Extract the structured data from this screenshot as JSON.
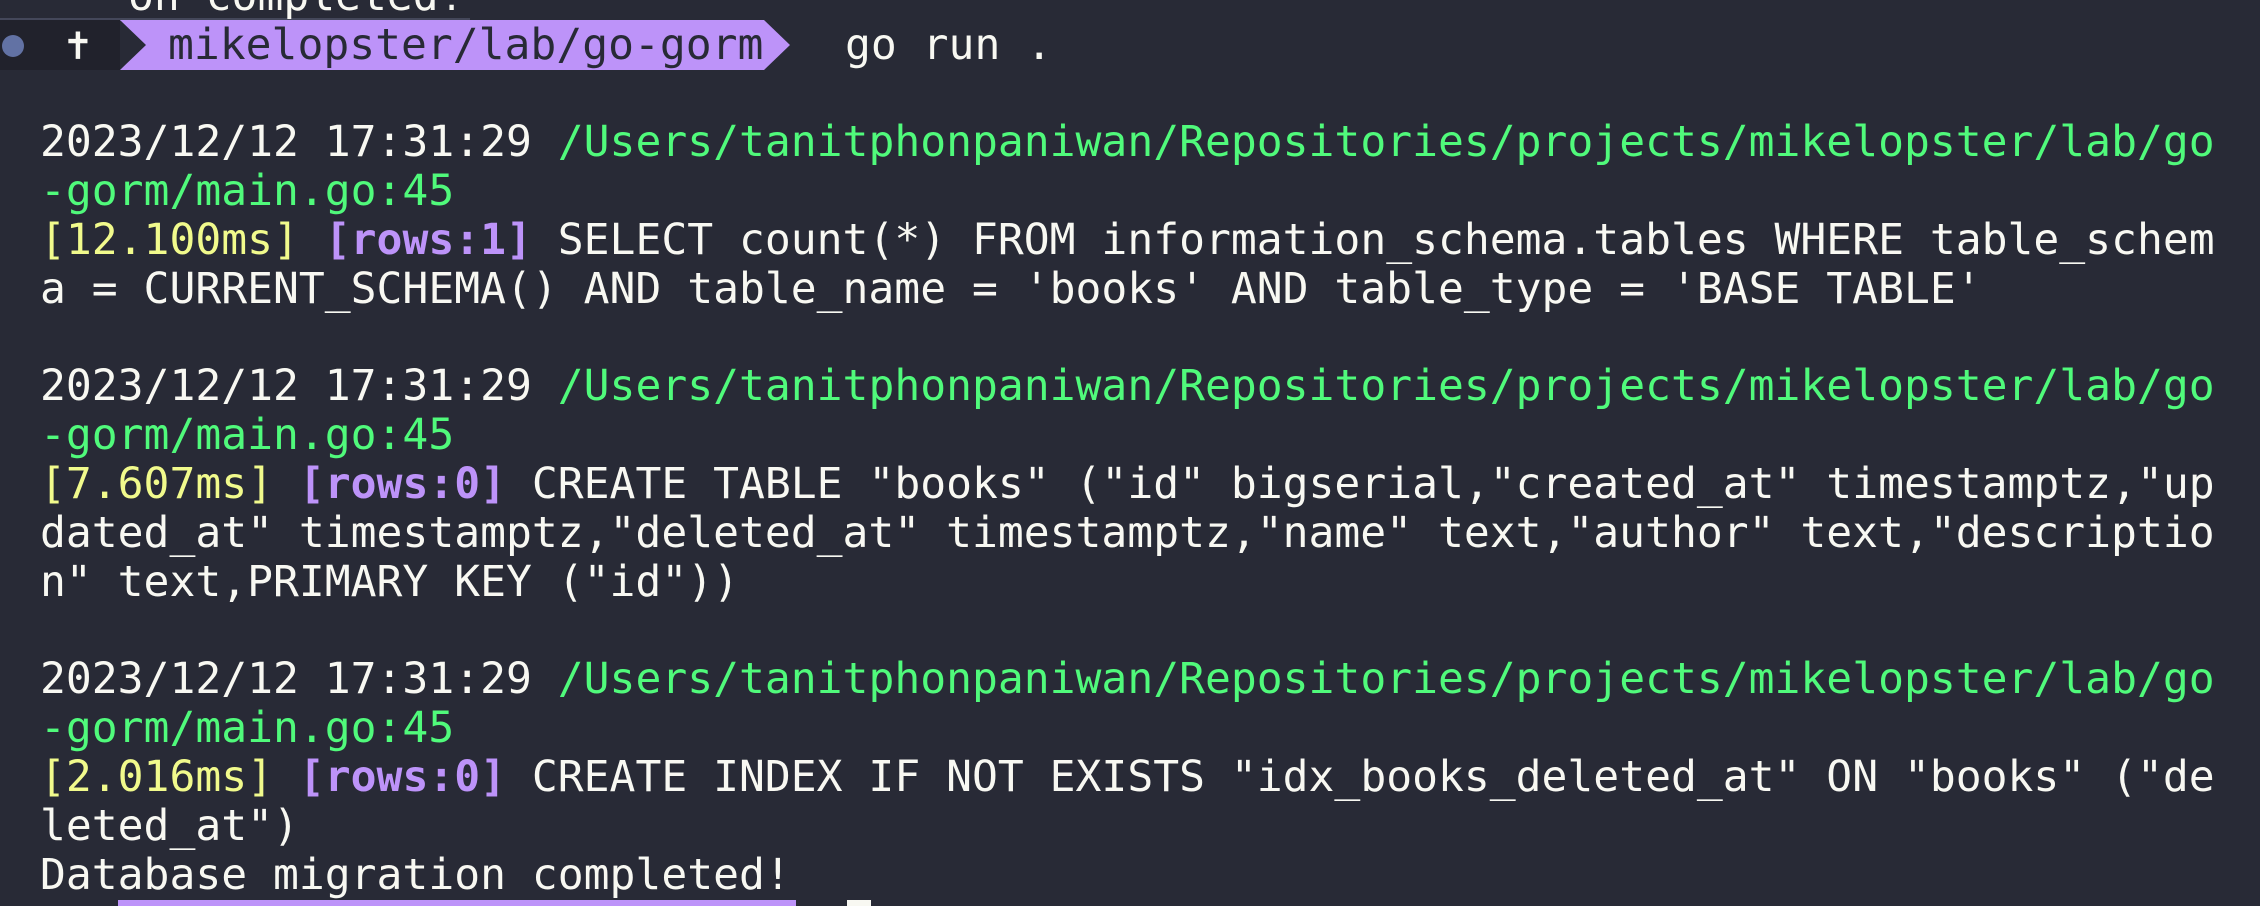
{
  "terminal": {
    "previous_output": "on completed!",
    "prompt": {
      "icon": "✝",
      "path": "mikelopster/lab/go-gorm",
      "command": "go run ."
    },
    "log_entries": [
      {
        "timestamp": "2023/12/12 17:31:29",
        "path_part1": "/Users/tanitphonpaniwan/Repositories/projects/mikelopster/lab/go",
        "path_part2": "-gorm/main.go:45",
        "duration": "[12.100ms]",
        "rows": "[rows:1]",
        "sql_line1": "SELECT count(*) FROM information_schema.tables WHERE table_schem",
        "sql_line2": "a = CURRENT_SCHEMA() AND table_name = 'books' AND table_type = 'BASE TABLE'",
        "sql_line3": ""
      },
      {
        "timestamp": "2023/12/12 17:31:29",
        "path_part1": "/Users/tanitphonpaniwan/Repositories/projects/mikelopster/lab/go",
        "path_part2": "-gorm/main.go:45",
        "duration": "[7.607ms]",
        "rows": "[rows:0]",
        "sql_line1": "CREATE TABLE \"books\" (\"id\" bigserial,\"created_at\" timestamptz,\"up",
        "sql_line2": "dated_at\" timestamptz,\"deleted_at\" timestamptz,\"name\" text,\"author\" text,\"descriptio",
        "sql_line3": "n\" text,PRIMARY KEY (\"id\"))"
      },
      {
        "timestamp": "2023/12/12 17:31:29",
        "path_part1": "/Users/tanitphonpaniwan/Repositories/projects/mikelopster/lab/go",
        "path_part2": "-gorm/main.go:45",
        "duration": "[2.016ms]",
        "rows": "[rows:0]",
        "sql_line1": "CREATE INDEX IF NOT EXISTS \"idx_books_deleted_at\" ON \"books\" (\"de",
        "sql_line2": "leted_at\")",
        "sql_line3": ""
      }
    ],
    "final_message": "Database migration completed!"
  },
  "colors": {
    "background": "#282a36",
    "path": "#50fa7b",
    "duration": "#f1fa8c",
    "rows": "#bd93f9",
    "prompt_segment": "#bd93f9"
  }
}
